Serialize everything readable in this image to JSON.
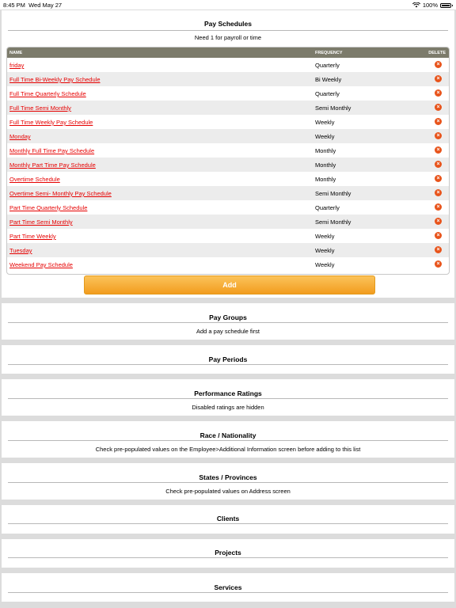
{
  "status": {
    "time": "8:45 PM",
    "date": "Wed May 27",
    "battery": "100%"
  },
  "pay_schedules": {
    "title": "Pay Schedules",
    "subtitle": "Need 1 for payroll or time",
    "headers": {
      "name": "NAME",
      "frequency": "FREQUENCY",
      "delete": "DELETE"
    },
    "rows": [
      {
        "name": "friday",
        "frequency": "Quarterly"
      },
      {
        "name": "Full Time Bi-Weekly Pay Schedule",
        "frequency": "Bi Weekly"
      },
      {
        "name": "Full Time Quarterly Schedule",
        "frequency": "Quarterly"
      },
      {
        "name": "Full Time Semi Monthly",
        "frequency": "Semi Monthly"
      },
      {
        "name": "Full Time Weekly Pay Schedule",
        "frequency": "Weekly"
      },
      {
        "name": "Monday",
        "frequency": "Weekly"
      },
      {
        "name": "Monthly Full Time Pay Schedule",
        "frequency": "Monthly"
      },
      {
        "name": "Monthly Part Time Pay Schedule",
        "frequency": "Monthly"
      },
      {
        "name": "Overtime Schedule",
        "frequency": "Monthly"
      },
      {
        "name": "Overtime Semi- Monthly Pay Schedule",
        "frequency": "Semi Monthly"
      },
      {
        "name": "Part Time Quarterly Schedule",
        "frequency": "Quarterly"
      },
      {
        "name": "Part Time Semi Monthly",
        "frequency": "Semi Monthly"
      },
      {
        "name": "Part Time Weekly",
        "frequency": "Weekly"
      },
      {
        "name": "Tuesday",
        "frequency": "Weekly"
      },
      {
        "name": "Weekend Pay Schedule",
        "frequency": "Weekly"
      }
    ],
    "add_label": "Add"
  },
  "sections": {
    "pay_groups": {
      "title": "Pay Groups",
      "subtitle": "Add a pay schedule first"
    },
    "pay_periods": {
      "title": "Pay Periods"
    },
    "performance_ratings": {
      "title": "Performance Ratings",
      "subtitle": "Disabled ratings are hidden"
    },
    "race_nationality": {
      "title": "Race / Nationality",
      "subtitle": "Check pre-populated values on the Employee>Additional Information screen before adding to this list"
    },
    "states_provinces": {
      "title": "States / Provinces",
      "subtitle": "Check pre-populated values on Address screen"
    },
    "clients": {
      "title": "Clients"
    },
    "projects": {
      "title": "Projects"
    },
    "services": {
      "title": "Services"
    }
  },
  "colors": {
    "accent": "#f29c1e",
    "link": "#e60000",
    "header_bg": "#7c7b6b",
    "delete": "#e8541b"
  }
}
